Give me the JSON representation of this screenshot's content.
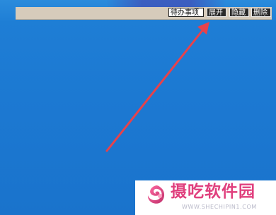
{
  "toolbar": {
    "todo_label": "待办事项",
    "expand_label": "展开",
    "hide_label": "隐藏",
    "delete_label": "删除"
  },
  "watermark": {
    "title": "摄吃软件园",
    "url": "WWW.SHECHIPIN1.COM"
  },
  "colors": {
    "desktop": "#1c79d2",
    "toolbar": "#d6cbbb",
    "arrow": "#e8424a",
    "logo_pink": "#e0407e"
  },
  "icons": {
    "arrow": "red-pointer-arrow",
    "logo": "swirl-logo-icon"
  }
}
